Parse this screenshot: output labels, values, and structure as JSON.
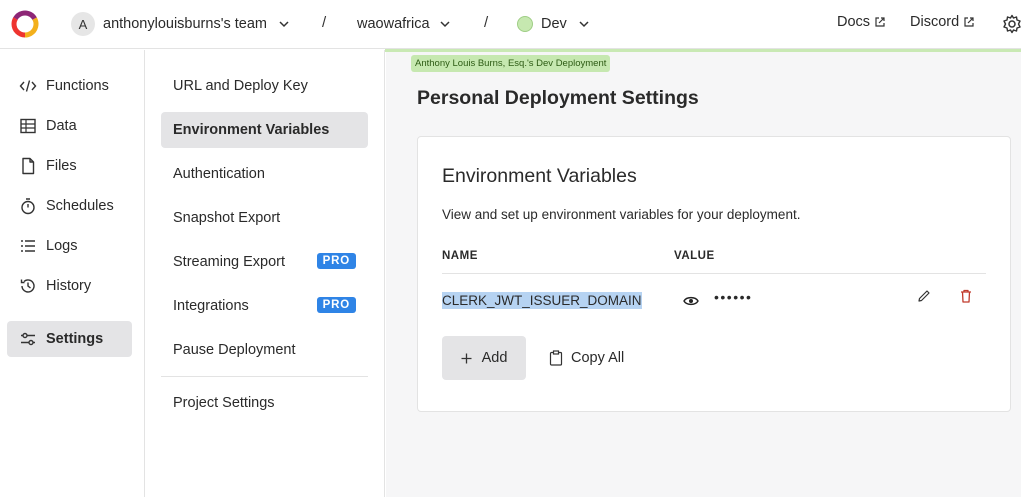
{
  "header": {
    "team_avatar": "A",
    "team_name": "anthonylouisburns's team",
    "separator": "/",
    "project_name": "waowafrica",
    "deployment_name": "Dev",
    "docs_label": "Docs",
    "discord_label": "Discord",
    "icons": [
      "convex-logo",
      "chevron-down-icon",
      "external-link-icon",
      "gear-icon"
    ]
  },
  "sidebar": {
    "items": [
      {
        "label": "Functions",
        "icon": "code-icon"
      },
      {
        "label": "Data",
        "icon": "table-icon"
      },
      {
        "label": "Files",
        "icon": "file-icon"
      },
      {
        "label": "Schedules",
        "icon": "stopwatch-icon"
      },
      {
        "label": "Logs",
        "icon": "list-icon"
      },
      {
        "label": "History",
        "icon": "history-icon"
      },
      {
        "label": "Settings",
        "icon": "sliders-icon",
        "active": true
      }
    ]
  },
  "settings_nav": {
    "items": [
      {
        "label": "URL and Deploy Key"
      },
      {
        "label": "Environment Variables",
        "active": true
      },
      {
        "label": "Authentication"
      },
      {
        "label": "Snapshot Export"
      },
      {
        "label": "Streaming Export",
        "badge": "PRO"
      },
      {
        "label": "Integrations",
        "badge": "PRO"
      },
      {
        "label": "Pause Deployment"
      },
      {
        "label": "Project Settings"
      }
    ]
  },
  "main": {
    "deployment_badge": "Anthony Louis Burns, Esq.'s Dev Deployment",
    "page_title": "Personal Deployment Settings",
    "card": {
      "title": "Environment Variables",
      "description": "View and set up environment variables for your deployment.",
      "columns": [
        "NAME",
        "VALUE"
      ],
      "rows": [
        {
          "name": "CLERK_JWT_ISSUER_DOMAIN",
          "value_masked": "••••••"
        }
      ],
      "add_label": "Add",
      "copy_all_label": "Copy All"
    }
  },
  "colors": {
    "accent_pro": "#2f84e6",
    "deployment_green": "#c6e8b0",
    "selection_highlight": "#b6d3f2",
    "delete_red": "#c0392b"
  }
}
